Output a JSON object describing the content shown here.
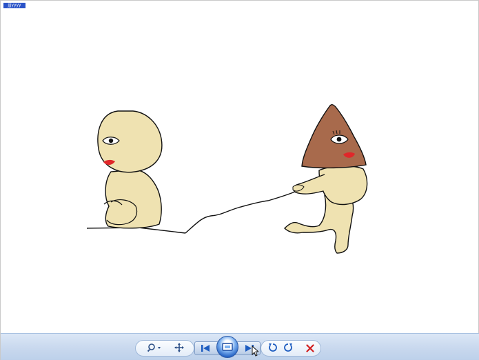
{
  "viewer": {
    "title_tag": "jjjyyyy",
    "colors": {
      "toolbar": "#c8d8ee",
      "skin": "#efe2b1",
      "triangle_head": "#a86a4c",
      "lips": "#e0272a",
      "delete_red": "#d21e1e",
      "nav_blue": "#1d5cc0"
    }
  },
  "toolbar": {
    "zoom": {
      "icon": "magnifier-zoom-icon"
    },
    "actual_size": {
      "icon": "fit-to-window-icon"
    },
    "previous": {
      "icon": "previous-icon"
    },
    "slideshow": {
      "icon": "slideshow-icon"
    },
    "next": {
      "icon": "next-icon"
    },
    "rotate_ccw": {
      "icon": "rotate-counterclockwise-icon"
    },
    "rotate_cw": {
      "icon": "rotate-clockwise-icon"
    },
    "delete": {
      "icon": "delete-icon"
    }
  }
}
